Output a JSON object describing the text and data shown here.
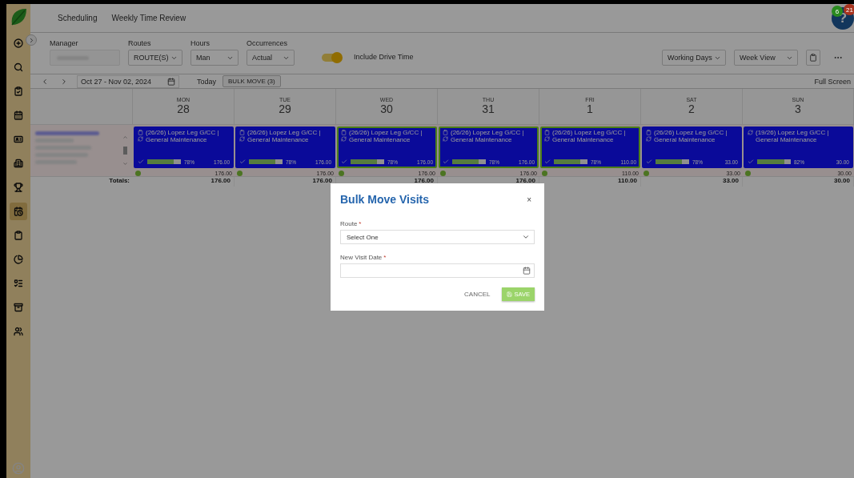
{
  "header": {
    "breadcrumbs": [
      {
        "label": "Scheduling"
      },
      {
        "label": "Weekly Time Review"
      }
    ]
  },
  "help": {
    "label": "?",
    "badges": [
      {
        "count": "6",
        "color": "#2a8a1f"
      },
      {
        "count": "21",
        "color": "#a8341f"
      }
    ]
  },
  "sidebar": {
    "items": [
      {
        "selected": false
      },
      {
        "selected": false
      },
      {
        "selected": false
      },
      {
        "selected": false
      },
      {
        "selected": false
      },
      {
        "selected": false
      },
      {
        "selected": false
      },
      {
        "selected": true
      },
      {
        "selected": false
      },
      {
        "selected": false
      },
      {
        "selected": false
      },
      {
        "selected": false
      },
      {
        "selected": false
      }
    ]
  },
  "filters": [
    {
      "label": "Manager",
      "kind": "blurred"
    },
    {
      "label": "Routes",
      "value": "ROUTE(S)",
      "kind": "select"
    },
    {
      "label": "Hours",
      "value": "Man",
      "kind": "select"
    },
    {
      "label": "Occurrences",
      "value": "Actual",
      "kind": "select"
    }
  ],
  "drive_time_toggle": {
    "label": "Include Drive Time",
    "on": true
  },
  "view_selects": [
    {
      "value": "Working Days"
    },
    {
      "value": "Week View"
    }
  ],
  "date_nav": {
    "range": "Oct 27 - Nov 02, 2024",
    "today": "Today",
    "bulk_move": "BULK MOVE (3)",
    "full_screen": "Full Screen"
  },
  "days": [
    {
      "weekday": "MON",
      "date": "28",
      "card": {
        "title": "(26/26) Lopez Leg G/CC |",
        "subtitle": "General Maintenance",
        "clipboard": true,
        "selected": false,
        "level": 0.78,
        "percent": "78%",
        "hours": "176.00"
      },
      "day_hours": "176.00",
      "total": "176.00"
    },
    {
      "weekday": "TUE",
      "date": "29",
      "card": {
        "title": "(26/26) Lopez Leg G/CC |",
        "subtitle": "General Maintenance",
        "clipboard": true,
        "selected": false,
        "level": 0.78,
        "percent": "78%",
        "hours": "176.00"
      },
      "day_hours": "176.00",
      "total": "176.00"
    },
    {
      "weekday": "WED",
      "date": "30",
      "card": {
        "title": "(26/26) Lopez Leg G/CC |",
        "subtitle": "General Maintenance",
        "clipboard": true,
        "selected": true,
        "level": 0.78,
        "percent": "78%",
        "hours": "176.00"
      },
      "day_hours": "176.00",
      "total": "176.00"
    },
    {
      "weekday": "THU",
      "date": "31",
      "card": {
        "title": "(26/26) Lopez Leg G/CC |",
        "subtitle": "General Maintenance",
        "clipboard": true,
        "selected": true,
        "level": 0.78,
        "percent": "78%",
        "hours": "176.00"
      },
      "day_hours": "176.00",
      "total": "176.00"
    },
    {
      "weekday": "FRI",
      "date": "1",
      "card": {
        "title": "(26/26) Lopez Leg G/CC |",
        "subtitle": "General Maintenance",
        "clipboard": true,
        "selected": true,
        "level": 0.78,
        "percent": "78%",
        "hours": "110.00"
      },
      "day_hours": "110.00",
      "total": "110.00"
    },
    {
      "weekday": "SAT",
      "date": "2",
      "card": {
        "title": "(26/26) Lopez Leg G/CC |",
        "subtitle": "General Maintenance",
        "clipboard": true,
        "selected": false,
        "level": 0.78,
        "percent": "78%",
        "hours": "33.00"
      },
      "day_hours": "33.00",
      "total": "33.00"
    },
    {
      "weekday": "SUN",
      "date": "3",
      "card": {
        "title": "(19/26) Lopez Leg G/CC |",
        "subtitle": "General Maintenance",
        "clipboard": false,
        "selected": false,
        "level": 0.82,
        "percent": "82%",
        "hours": "30.00"
      },
      "day_hours": "30.00",
      "total": "30.00"
    }
  ],
  "totals_label": "Totals:",
  "modal": {
    "title": "Bulk Move Visits",
    "close": "×",
    "fields": [
      {
        "label": "Route",
        "required": "*",
        "kind": "select",
        "value": "Select One"
      },
      {
        "label": "New Visit Date",
        "required": "*",
        "kind": "date"
      }
    ],
    "cancel": "CANCEL",
    "save": "SAVE"
  }
}
